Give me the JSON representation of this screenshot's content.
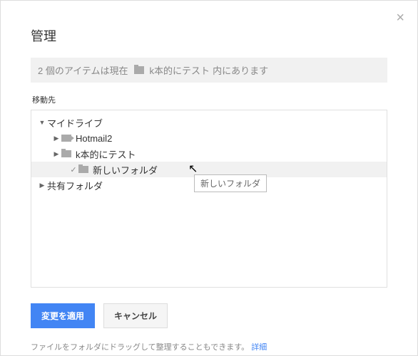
{
  "title": "管理",
  "status": {
    "prefix": "2 個のアイテムは現在",
    "folder": "k本的にテスト",
    "suffix": "内にあります"
  },
  "dest_label": "移動先",
  "tree": {
    "mydrive": "マイドライブ",
    "hotmail": "Hotmail2",
    "ktest": "k本的にテスト",
    "newfolder": "新しいフォルダ",
    "shared": "共有フォルダ"
  },
  "tooltip": "新しいフォルダ",
  "buttons": {
    "apply": "変更を適用",
    "cancel": "キャンセル"
  },
  "footer": {
    "text": "ファイルをフォルダにドラッグして整理することもできます。",
    "link": "詳細"
  }
}
